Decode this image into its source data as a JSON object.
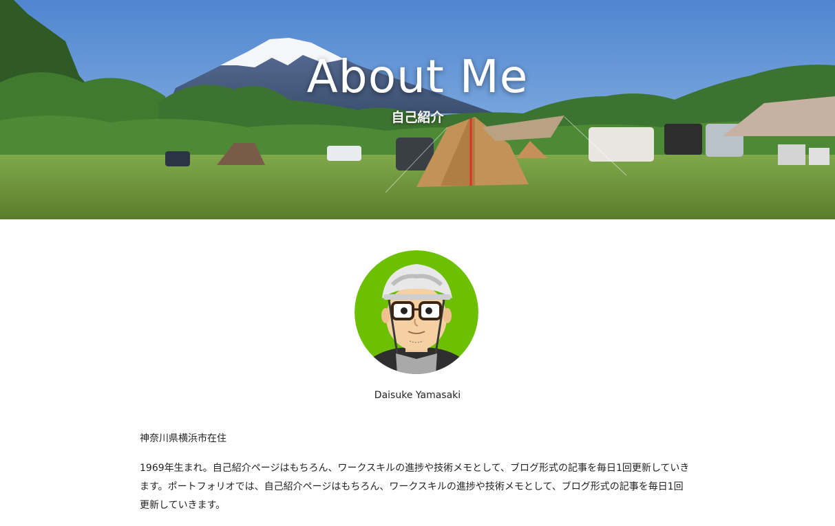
{
  "hero": {
    "title": "About Me",
    "subtitle": "自己紹介"
  },
  "profile": {
    "name": "Daisuke Yamasaki",
    "avatar_bg": "#6cc000"
  },
  "content": {
    "location": "神奈川県横浜市在住",
    "bio": "1969年生まれ。自己紹介ページはもちろん、ワークスキルの進捗や技術メモとして、ブログ形式の記事を毎日1回更新していきます。ポートフォリオでは、自己紹介ページはもちろん、ワークスキルの進捗や技術メモとして、ブログ形式の記事を毎日1回更新していきます。"
  },
  "colors": {
    "sky": "#5f95d6",
    "grass": "#6f9a3a",
    "text": "#222222"
  }
}
